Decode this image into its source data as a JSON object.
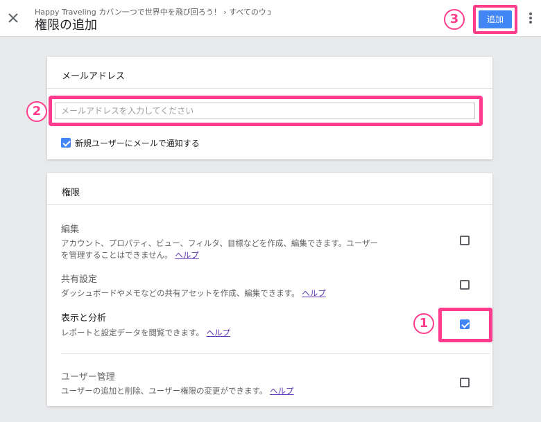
{
  "header": {
    "breadcrumb": "Happy Traveling カバン一つで世界中を飛び回ろう！ › すべてのウェ…",
    "title": "権限の追加",
    "add_label": "追加",
    "close_icon": "close-icon",
    "more_icon": "more-vert-icon"
  },
  "annotations": {
    "one": "1",
    "two": "2",
    "three": "3"
  },
  "email_card": {
    "heading": "メールアドレス",
    "input_value": "",
    "input_placeholder": "メールアドレスを入力してください",
    "notify_label": "新規ユーザーにメールで通知する",
    "notify_checked": true
  },
  "permissions_card": {
    "heading": "権限",
    "help_label": "ヘルプ",
    "items": [
      {
        "title": "編集",
        "desc": "アカウント、プロパティ、ビュー、フィルタ、目標などを作成、編集できます。ユーザーを管理することはできません。",
        "checked": false
      },
      {
        "title": "共有設定",
        "desc": "ダッシュボードやメモなどの共有アセットを作成、編集できます。",
        "checked": false
      },
      {
        "title": "表示と分析",
        "desc": "レポートと設定データを閲覧できます。",
        "checked": true
      },
      {
        "title": "ユーザー管理",
        "desc": "ユーザーの追加と削除、ユーザー権限の変更ができます。",
        "checked": false
      }
    ]
  },
  "colors": {
    "accent": "#4285f4",
    "highlight": "#ff3d8c",
    "link": "#5e35b1"
  }
}
